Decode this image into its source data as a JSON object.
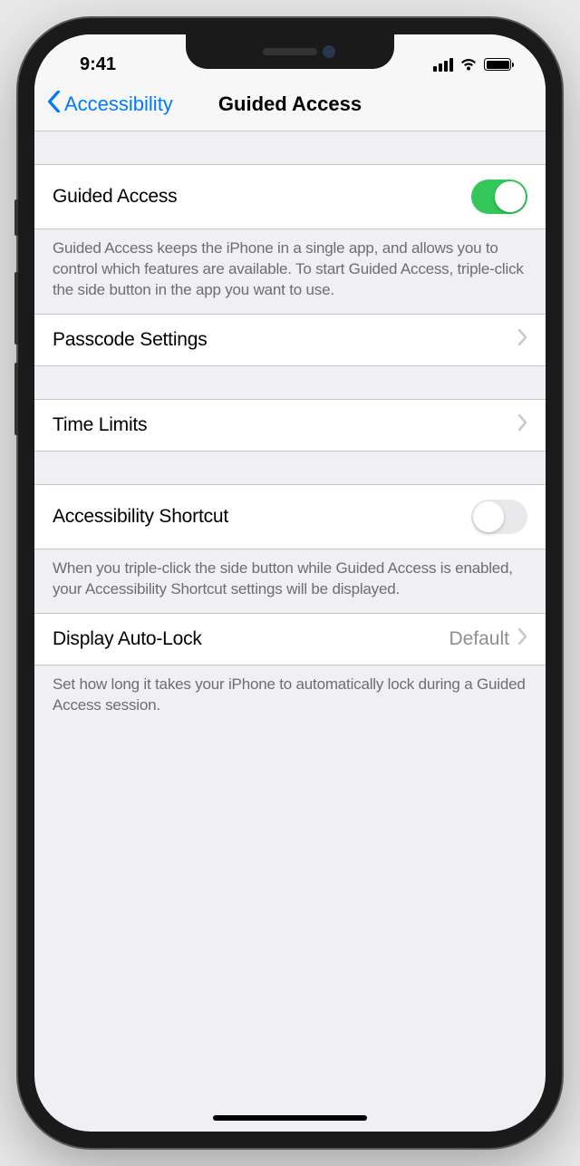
{
  "status": {
    "time": "9:41"
  },
  "nav": {
    "back_label": "Accessibility",
    "title": "Guided Access"
  },
  "sections": {
    "main": {
      "toggle_label": "Guided Access",
      "toggle_on": true,
      "footer": "Guided Access keeps the iPhone in a single app, and allows you to control which features are available. To start Guided Access, triple-click the side button in the app you want to use."
    },
    "passcode": {
      "label": "Passcode Settings"
    },
    "time_limits": {
      "label": "Time Limits"
    },
    "shortcut": {
      "toggle_label": "Accessibility Shortcut",
      "toggle_on": false,
      "footer": "When you triple-click the side button while Guided Access is enabled, your Accessibility Shortcut settings will be displayed."
    },
    "autolock": {
      "label": "Display Auto-Lock",
      "value": "Default",
      "footer": "Set how long it takes your iPhone to automatically lock during a Guided Access session."
    }
  }
}
